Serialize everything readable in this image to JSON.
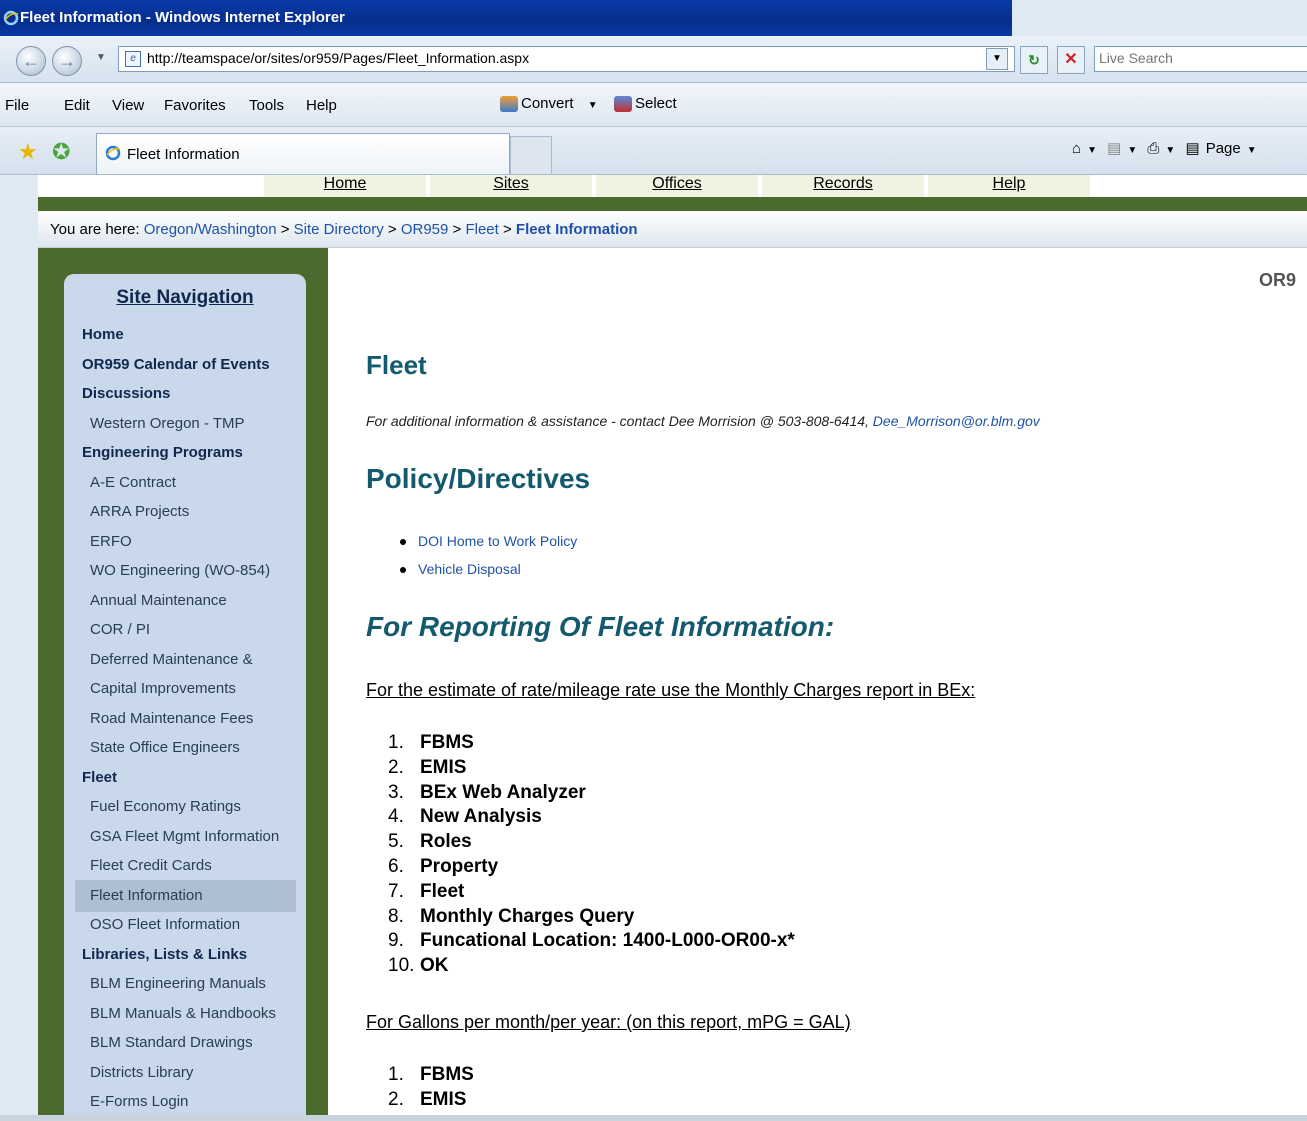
{
  "window": {
    "title": "Fleet Information - Windows Internet Explorer"
  },
  "address_bar": {
    "url": "http://teamspace/or/sites/or959/Pages/Fleet_Information.aspx",
    "search_placeholder": "Live Search"
  },
  "menu": {
    "items": [
      "File",
      "Edit",
      "View",
      "Favorites",
      "Tools",
      "Help"
    ],
    "convert_label": "Convert",
    "select_label": "Select"
  },
  "tabs": {
    "active_label": "Fleet Information",
    "page_label": "Page"
  },
  "top_nav": [
    "Home",
    "Sites",
    "Offices",
    "Records",
    "Help"
  ],
  "breadcrumb": {
    "prefix": "You are here:",
    "items": [
      "Oregon/Washington",
      "Site Directory",
      "OR959",
      "Fleet"
    ],
    "current": "Fleet Information"
  },
  "sidebar": {
    "heading": "Site Navigation",
    "items": [
      {
        "label": "Home",
        "bold": true
      },
      {
        "label": "OR959 Calendar of Events",
        "bold": true
      },
      {
        "label": "Discussions",
        "bold": true
      },
      {
        "label": "Western Oregon - TMP",
        "bold": false
      },
      {
        "label": "Engineering Programs",
        "bold": true
      },
      {
        "label": "A-E Contract",
        "bold": false
      },
      {
        "label": "ARRA Projects",
        "bold": false
      },
      {
        "label": "ERFO",
        "bold": false
      },
      {
        "label": "WO Engineering (WO-854)",
        "bold": false
      },
      {
        "label": "Annual Maintenance",
        "bold": false
      },
      {
        "label": "COR / PI",
        "bold": false
      },
      {
        "label": "Deferred Maintenance &",
        "bold": false
      },
      {
        "label": "Capital Improvements",
        "bold": false
      },
      {
        "label": "Road Maintenance Fees",
        "bold": false
      },
      {
        "label": "State Office Engineers",
        "bold": false
      },
      {
        "label": "Fleet",
        "bold": true
      },
      {
        "label": "Fuel Economy Ratings",
        "bold": false
      },
      {
        "label": "GSA Fleet Mgmt Information",
        "bold": false
      },
      {
        "label": "Fleet Credit Cards",
        "bold": false
      },
      {
        "label": "Fleet Information",
        "bold": false,
        "selected": true
      },
      {
        "label": "OSO Fleet Information",
        "bold": false
      },
      {
        "label": "Libraries, Lists & Links",
        "bold": true
      },
      {
        "label": "BLM Engineering Manuals",
        "bold": false
      },
      {
        "label": "BLM Manuals & Handbooks",
        "bold": false
      },
      {
        "label": "BLM Standard Drawings",
        "bold": false
      },
      {
        "label": "Districts Library",
        "bold": false
      },
      {
        "label": "E-Forms Login",
        "bold": false
      }
    ]
  },
  "main": {
    "site_tag": "OR9",
    "title": "Fleet",
    "contact_text": "For additional information & assistance - contact Dee Morrision @ 503-808-6414, ",
    "contact_email": "Dee_Morrison@or.blm.gov",
    "policy_heading": "Policy/Directives",
    "policy_links": [
      "DOI Home to Work Policy",
      "Vehicle Disposal"
    ],
    "reporting_heading": "For Reporting Of Fleet Information:",
    "section1_heading": "For the estimate of rate/mileage rate use the Monthly Charges report in BEx:",
    "section1_steps": [
      "FBMS",
      "EMIS",
      "BEx Web Analyzer",
      "New Analysis",
      "Roles",
      "Property",
      "Fleet",
      "Monthly Charges Query",
      "Funcational Location: 1400-L000-OR00-x*",
      "OK"
    ],
    "section2_heading": "For Gallons per month/per year: (on this report, mPG = GAL)",
    "section2_steps": [
      "FBMS",
      "EMIS"
    ]
  }
}
